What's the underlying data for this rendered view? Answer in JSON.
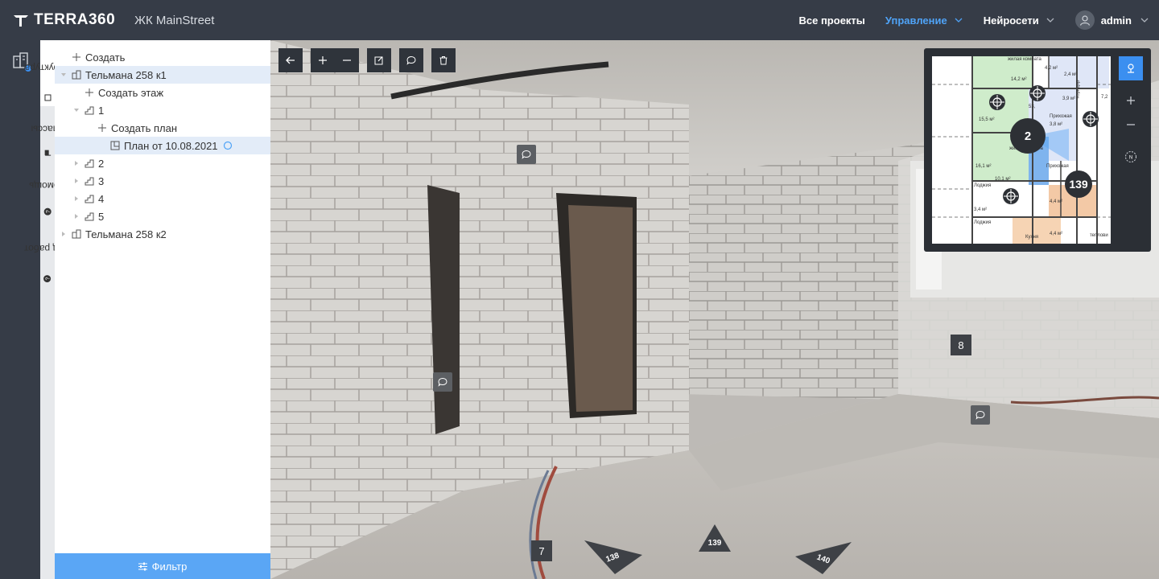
{
  "app": {
    "logo_text": "TERRA360",
    "project_name": "ЖК MainStreet"
  },
  "nav": {
    "all_projects": "Все проекты",
    "management": "Управление",
    "neural": "Нейросети",
    "user": "admin"
  },
  "tabs": {
    "structure": "Структура",
    "classes": "Классы",
    "help": "Помощь",
    "work_type": "Вид работ"
  },
  "tree": {
    "create": "Создать",
    "building1": "Тельмана 258 к1",
    "create_floor": "Создать этаж",
    "floor1": "1",
    "create_plan": "Создать план",
    "plan": "План от 10.08.2021",
    "floor2": "2",
    "floor3": "3",
    "floor4": "4",
    "floor5": "5",
    "building2": "Тельмана 258 к2"
  },
  "filter_label": "Фильтр",
  "panorama": {
    "marker_7": "7",
    "marker_8": "8",
    "arrow_138": "138",
    "arrow_139": "139",
    "arrow_140": "140"
  },
  "minimap": {
    "current_point": "2",
    "point_139": "139",
    "room_labels": {
      "zhilaya_top": "жилая комната",
      "area_142": "14,2 м²",
      "area_42": "4,2 м²",
      "area_24": "2,4 м²",
      "area_39": "3,9 м²",
      "prikhozhaya_top": "Прихожая",
      "area_38": "3,8 м²",
      "area_155": "15,5 м²",
      "zhilaya_mid": "жилая комната",
      "area_161": "16,1 м²",
      "area_101": "10,1 м²",
      "prikhozhaya_mid": "Прихожая",
      "lodzhiya1": "Лоджия",
      "lodzhiya2": "Лоджия",
      "area_44a": "4,4 м²",
      "area_44b": "4,4 м²",
      "area_34": "3,4 м²",
      "kukhnya": "Кухня",
      "koridor": "коридор",
      "area_72": "7,2",
      "area_533": "53,",
      "teplo": "теплови"
    }
  },
  "colors": {
    "accent": "#4fa3f7",
    "topbar": "#363c47",
    "filter": "#5aa6f5"
  }
}
